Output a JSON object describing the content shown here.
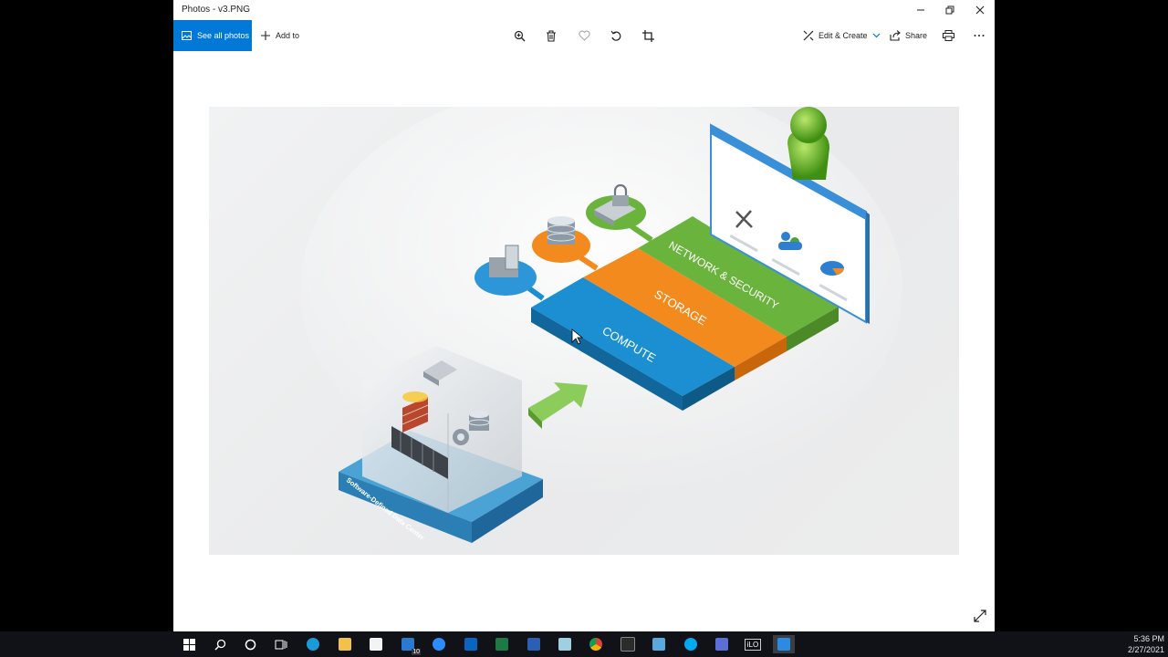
{
  "window": {
    "title": "Photos - v3.PNG",
    "minimize_icon": "minimize-icon",
    "restore_icon": "restore-icon",
    "close_icon": "close-icon"
  },
  "toolbar": {
    "see_all_photos": "See all photos",
    "add_to": "Add to",
    "edit_create": "Edit & Create",
    "share": "Share",
    "icons": [
      "zoom-icon",
      "delete-icon",
      "favorite-icon",
      "rotate-icon",
      "crop-icon",
      "print-icon",
      "more-icon"
    ]
  },
  "image": {
    "layers": {
      "network": "NETWORK & SECURITY",
      "storage": "STORAGE",
      "compute": "COMPUTE"
    },
    "base_label": "Software-Defined Data Center",
    "colors": {
      "compute": "#1b8fd2",
      "storage": "#f28a1e",
      "network": "#6ab43e",
      "base": "#4aa3d4"
    }
  },
  "taskbar": {
    "time": "5:36 PM",
    "date": "2/27/2021",
    "ilo_label": "iLO",
    "mail_badge": "10",
    "apps": [
      "start",
      "search",
      "cortana",
      "task-view",
      "edge",
      "file-explorer",
      "store",
      "mail",
      "zoom",
      "outlook",
      "excel",
      "word",
      "notepad",
      "chrome",
      "terminal",
      "remote-desktop",
      "skype",
      "app-2",
      "ilo",
      "photos"
    ]
  }
}
